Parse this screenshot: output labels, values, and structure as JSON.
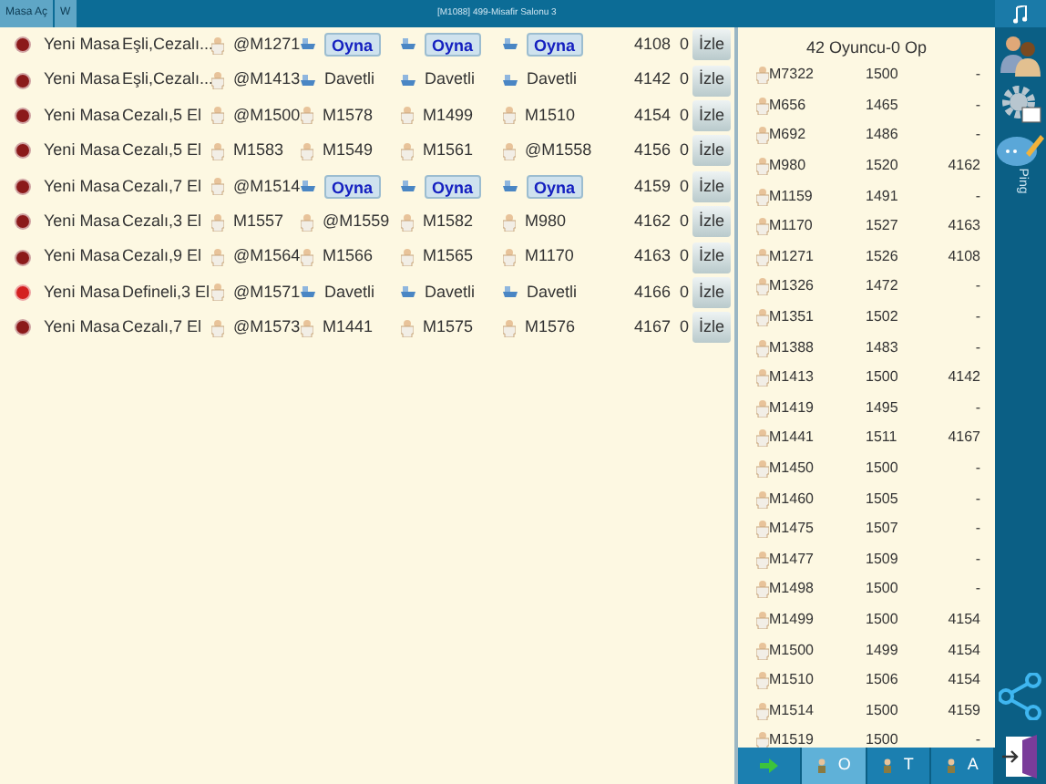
{
  "toolbar": {
    "buttons": [
      "Masa Aç",
      "W"
    ],
    "title": "[M1088] 499-Misafir Salonu 3"
  },
  "tables": [
    {
      "color": "#8b1a1a",
      "name": "Yeni Masa",
      "type": "Eşli,Cezalı...",
      "seats": [
        {
          "kind": "player",
          "text": "@M1271"
        },
        {
          "kind": "play",
          "text": "Oyna"
        },
        {
          "kind": "play",
          "text": "Oyna"
        },
        {
          "kind": "play",
          "text": "Oyna"
        }
      ],
      "id": "4108",
      "count": "0",
      "watch": "İzle"
    },
    {
      "color": "#8b1a1a",
      "name": "Yeni Masa",
      "type": "Eşli,Cezalı...",
      "seats": [
        {
          "kind": "player",
          "text": "@M1413"
        },
        {
          "kind": "invited",
          "text": "Davetli"
        },
        {
          "kind": "invited",
          "text": "Davetli"
        },
        {
          "kind": "invited",
          "text": "Davetli"
        }
      ],
      "id": "4142",
      "count": "0",
      "watch": "İzle"
    },
    {
      "color": "#8b1a1a",
      "name": "Yeni Masa",
      "type": "Cezalı,5 El",
      "seats": [
        {
          "kind": "player",
          "text": "@M1500"
        },
        {
          "kind": "player",
          "text": "M1578"
        },
        {
          "kind": "player",
          "text": "M1499"
        },
        {
          "kind": "player",
          "text": "M1510"
        }
      ],
      "id": "4154",
      "count": "0",
      "watch": "İzle"
    },
    {
      "color": "#8b1a1a",
      "name": "Yeni Masa",
      "type": "Cezalı,5 El",
      "seats": [
        {
          "kind": "player",
          "text": "M1583"
        },
        {
          "kind": "player",
          "text": "M1549"
        },
        {
          "kind": "player",
          "text": "M1561"
        },
        {
          "kind": "player",
          "text": "@M1558"
        }
      ],
      "id": "4156",
      "count": "0",
      "watch": "İzle"
    },
    {
      "color": "#8b1a1a",
      "name": "Yeni Masa",
      "type": "Cezalı,7 El",
      "seats": [
        {
          "kind": "player",
          "text": "@M1514"
        },
        {
          "kind": "play",
          "text": "Oyna"
        },
        {
          "kind": "play",
          "text": "Oyna"
        },
        {
          "kind": "play",
          "text": "Oyna"
        }
      ],
      "id": "4159",
      "count": "0",
      "watch": "İzle"
    },
    {
      "color": "#8b1a1a",
      "name": "Yeni Masa",
      "type": "Cezalı,3 El",
      "seats": [
        {
          "kind": "player",
          "text": "M1557"
        },
        {
          "kind": "player",
          "text": "@M1559"
        },
        {
          "kind": "player",
          "text": "M1582"
        },
        {
          "kind": "player",
          "text": "M980"
        }
      ],
      "id": "4162",
      "count": "0",
      "watch": "İzle"
    },
    {
      "color": "#8b1a1a",
      "name": "Yeni Masa",
      "type": "Cezalı,9 El",
      "seats": [
        {
          "kind": "player",
          "text": "@M1564"
        },
        {
          "kind": "player",
          "text": "M1566"
        },
        {
          "kind": "player",
          "text": "M1565"
        },
        {
          "kind": "player",
          "text": "M1170"
        }
      ],
      "id": "4163",
      "count": "0",
      "watch": "İzle"
    },
    {
      "color": "#d42020",
      "name": "Yeni Masa",
      "type": "Defineli,3 El",
      "seats": [
        {
          "kind": "player",
          "text": "@M1571"
        },
        {
          "kind": "invited",
          "text": "Davetli"
        },
        {
          "kind": "invited",
          "text": "Davetli"
        },
        {
          "kind": "invited",
          "text": "Davetli"
        }
      ],
      "id": "4166",
      "count": "0",
      "watch": "İzle"
    },
    {
      "color": "#8b1a1a",
      "name": "Yeni Masa",
      "type": "Cezalı,7 El",
      "seats": [
        {
          "kind": "player",
          "text": "@M1573"
        },
        {
          "kind": "player",
          "text": "M1441"
        },
        {
          "kind": "player",
          "text": "M1575"
        },
        {
          "kind": "player",
          "text": "M1576"
        }
      ],
      "id": "4167",
      "count": "0",
      "watch": "İzle"
    }
  ],
  "players": {
    "header": "42 Oyuncu-0 Op",
    "rows": [
      {
        "name": "M7322",
        "rating": "1500",
        "table": "-"
      },
      {
        "name": "M656",
        "rating": "1465",
        "table": "-"
      },
      {
        "name": "M692",
        "rating": "1486",
        "table": "-"
      },
      {
        "name": "M980",
        "rating": "1520",
        "table": "4162"
      },
      {
        "name": "M1159",
        "rating": "1491",
        "table": "-"
      },
      {
        "name": "M1170",
        "rating": "1527",
        "table": "4163"
      },
      {
        "name": "M1271",
        "rating": "1526",
        "table": "4108"
      },
      {
        "name": "M1326",
        "rating": "1472",
        "table": "-"
      },
      {
        "name": "M1351",
        "rating": "1502",
        "table": "-"
      },
      {
        "name": "M1388",
        "rating": "1483",
        "table": "-"
      },
      {
        "name": "M1413",
        "rating": "1500",
        "table": "4142"
      },
      {
        "name": "M1419",
        "rating": "1495",
        "table": "-"
      },
      {
        "name": "M1441",
        "rating": "1511",
        "table": "4167"
      },
      {
        "name": "M1450",
        "rating": "1500",
        "table": "-"
      },
      {
        "name": "M1460",
        "rating": "1505",
        "table": "-"
      },
      {
        "name": "M1475",
        "rating": "1507",
        "table": "-"
      },
      {
        "name": "M1477",
        "rating": "1509",
        "table": "-"
      },
      {
        "name": "M1498",
        "rating": "1500",
        "table": "-"
      },
      {
        "name": "M1499",
        "rating": "1500",
        "table": "4154"
      },
      {
        "name": "M1500",
        "rating": "1499",
        "table": "4154"
      },
      {
        "name": "M1510",
        "rating": "1506",
        "table": "4154"
      },
      {
        "name": "M1514",
        "rating": "1500",
        "table": "4159"
      },
      {
        "name": "M1519",
        "rating": "1500",
        "table": "-"
      }
    ]
  },
  "bottom_tabs": [
    {
      "kind": "arrow",
      "selected": false
    },
    {
      "kind": "label",
      "label": "O",
      "selected": true
    },
    {
      "kind": "label",
      "label": "T",
      "selected": false
    },
    {
      "kind": "label",
      "label": "A",
      "selected": false
    }
  ],
  "sidebar": {
    "ping_label": "Ping"
  }
}
